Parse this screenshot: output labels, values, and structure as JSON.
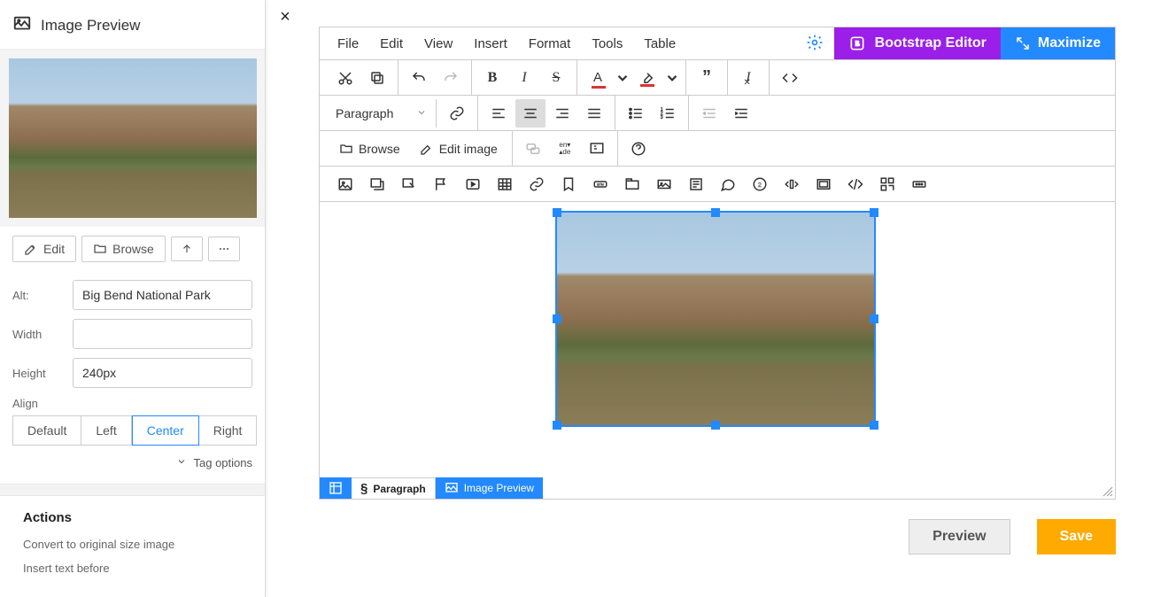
{
  "sidebar": {
    "title": "Image Preview",
    "buttons": {
      "edit": "Edit",
      "browse": "Browse"
    },
    "fields": {
      "alt_label": "Alt:",
      "alt_value": "Big Bend National Park",
      "width_label": "Width",
      "width_value": "",
      "height_label": "Height",
      "height_value": "240px",
      "align_label": "Align"
    },
    "align_options": [
      "Default",
      "Left",
      "Center",
      "Right"
    ],
    "align_active": "Center",
    "tag_options": "Tag options",
    "actions": {
      "heading": "Actions",
      "items": [
        "Convert to original size image",
        "Insert text before"
      ]
    }
  },
  "editor": {
    "menus": [
      "File",
      "Edit",
      "View",
      "Insert",
      "Format",
      "Tools",
      "Table"
    ],
    "bootstrap_label": "Bootstrap Editor",
    "maximize_label": "Maximize",
    "paragraph_selector": "Paragraph",
    "browse_btn": "Browse",
    "edit_image_btn": "Edit image",
    "path": {
      "paragraph": "Paragraph",
      "image_preview": "Image Preview"
    }
  },
  "footer": {
    "preview": "Preview",
    "save": "Save"
  }
}
